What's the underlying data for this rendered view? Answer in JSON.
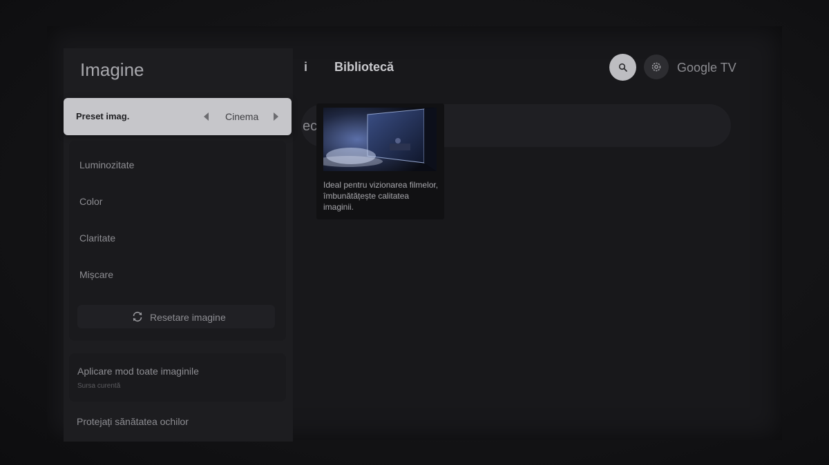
{
  "panel": {
    "title": "Imagine",
    "preset": {
      "label": "Preset imag.",
      "value": "Cinema"
    },
    "items": [
      {
        "label": "Luminozitate"
      },
      {
        "label": "Color"
      },
      {
        "label": "Claritate"
      },
      {
        "label": "Mișcare"
      }
    ],
    "reset_label": "Resetare imagine",
    "apply": {
      "label": "Aplicare mod toate imaginile",
      "sublabel": "Sursa curentă"
    },
    "eye_health_label": "Protejați sănătatea ochilor"
  },
  "description": {
    "text": "Ideal pentru vizionarea filmelor, îmbunătățește calitatea imaginii."
  },
  "home": {
    "partial_tab": "i",
    "library_tab": "Bibliotecă",
    "brand": "Google TV",
    "search_partial": "ec"
  },
  "icons": {
    "search": "search-icon",
    "settings": "gear-icon",
    "reset": "refresh-icon",
    "left": "chevron-left-icon",
    "right": "chevron-right-icon"
  },
  "colors": {
    "highlight": "#c6c6ca",
    "panel": "#1d1d20",
    "text": "#8e8e93"
  }
}
